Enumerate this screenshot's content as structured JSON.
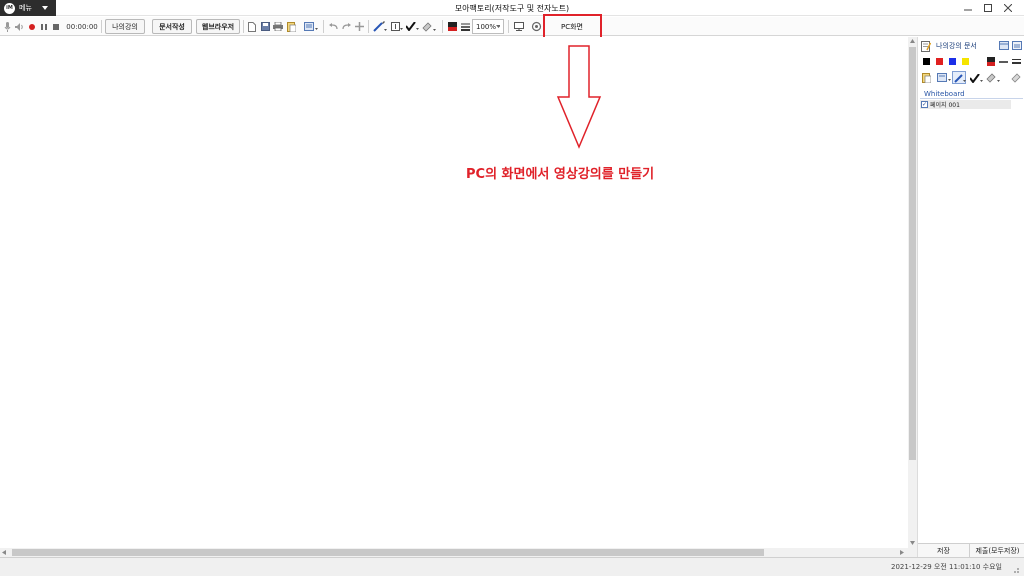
{
  "titlebar": {
    "menu_logo": "iM",
    "menu_label": "메뉴",
    "title": "모아팩토리(저작도구 및 전자노트)",
    "window_controls": [
      "minimize-icon",
      "maximize-icon",
      "close-icon"
    ]
  },
  "toolbar": {
    "timer": "00:00:00",
    "my_lecture_label": "나의강의",
    "doc_write_label": "문서작성",
    "web_browser_label": "웹브라우저",
    "zoom_value": "100%",
    "pc_screen_label": "PC화면",
    "icons": [
      "mic-icon",
      "speaker-icon",
      "record-icon",
      "pause-icon",
      "stop-icon",
      "new-page-icon",
      "save-icon",
      "print-icon",
      "import-icon",
      "slides-icon",
      "undo-icon",
      "redo-icon",
      "move-icon",
      "pen-icon",
      "textbox-icon",
      "checkmark-icon",
      "eraser-icon",
      "color-icon",
      "line-width-icon",
      "screen-icon",
      "settings-icon"
    ]
  },
  "annotation": {
    "text": "PC의 화면에서 영상강의를 만들기",
    "color": "#e0222a"
  },
  "panel": {
    "title": "나의강의 문서",
    "colors": [
      "#000000",
      "#e02020",
      "#1b2ee8",
      "#f5e400"
    ],
    "section_label": "Whiteboard",
    "page_label": "페이지 001",
    "save_label": "저장",
    "submit_label": "제출(모두저장)"
  },
  "statusbar": {
    "datetime": "2021-12-29 오전 11:01:10 수요일"
  }
}
